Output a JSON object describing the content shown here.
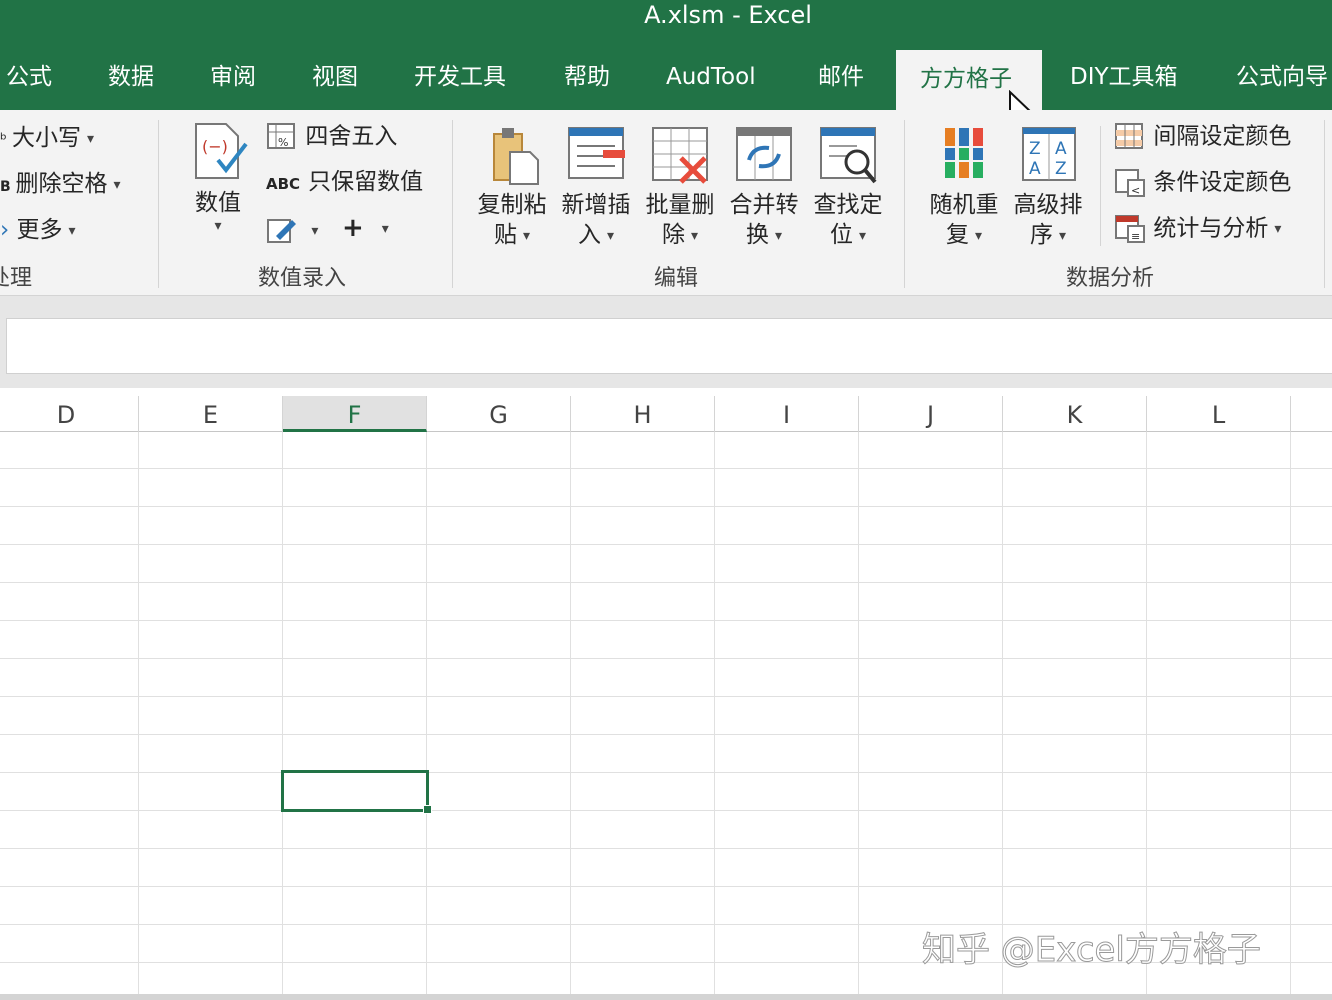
{
  "window": {
    "title": "A.xlsm  -  Excel"
  },
  "tabs": [
    {
      "label": "公式"
    },
    {
      "label": "数据"
    },
    {
      "label": "审阅"
    },
    {
      "label": "视图"
    },
    {
      "label": "开发工具"
    },
    {
      "label": "帮助"
    },
    {
      "label": "AudTool"
    },
    {
      "label": "邮件"
    },
    {
      "label": "方方格子"
    },
    {
      "label": "DIY工具箱"
    },
    {
      "label": "公式向导"
    }
  ],
  "active_tab": "方方格子",
  "ribbon": {
    "text_group": {
      "case_label": "大小写",
      "trim_label": "删除空格",
      "more_label": "更多",
      "group_label": "处理"
    },
    "numeric_group": {
      "value_line1": "数值",
      "round_label": "四舍五入",
      "keep_values_label": "只保留数值",
      "abc_text": "ABC",
      "plus_symbol": "+",
      "group_label": "数值录入"
    },
    "edit_group": {
      "copy_paste": [
        "复制粘",
        "贴"
      ],
      "insert": [
        "新增插",
        "入"
      ],
      "batch_delete": [
        "批量删",
        "除"
      ],
      "merge_convert": [
        "合并转",
        "换"
      ],
      "find_locate": [
        "查找定",
        "位"
      ],
      "group_label": "编辑"
    },
    "analysis_group": {
      "random_dup": [
        "随机重",
        "复"
      ],
      "advanced_sort": [
        "高级排",
        "序"
      ],
      "interval_color": "间隔设定颜色",
      "cond_color": "条件设定颜色",
      "stats": "统计与分析",
      "group_label": "数据分析"
    }
  },
  "formula_bar": {
    "value": ""
  },
  "columns": [
    "D",
    "E",
    "F",
    "G",
    "H",
    "I",
    "J",
    "K",
    "L"
  ],
  "selected_column": "F",
  "watermark": "知乎 @Excel方方格子",
  "colors": {
    "excel_green": "#217346",
    "ribbon_bg": "#f3f3f3"
  }
}
